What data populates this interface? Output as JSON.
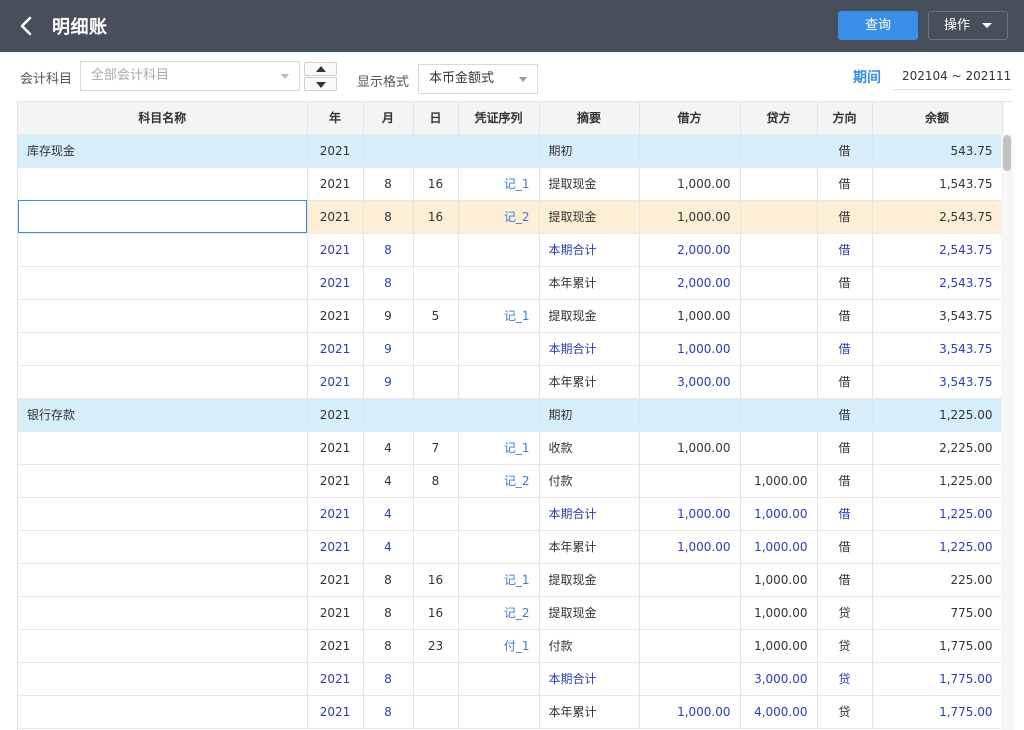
{
  "window": {
    "title": "明细账"
  },
  "toolbar": {
    "query_label": "查询",
    "ops_label": "操作"
  },
  "filters": {
    "account_label": "会计科目",
    "account_placeholder": "全部会计科目",
    "format_label": "显示格式",
    "format_value": "本币金额式",
    "period_label": "期间",
    "period_value": "202104 ~ 202111"
  },
  "table": {
    "headers": [
      "科目名称",
      "年",
      "月",
      "日",
      "凭证序列",
      "摘要",
      "借方",
      "贷方",
      "方向",
      "余额"
    ],
    "rows": [
      {
        "type": "group",
        "name": "库存现金",
        "year": "2021",
        "month": "",
        "day": "",
        "voucher": "",
        "summary": "期初",
        "debit": "",
        "credit": "",
        "dir": "借",
        "balance": "543.75"
      },
      {
        "type": "entry",
        "name": "",
        "year": "2021",
        "month": "8",
        "day": "16",
        "voucher": "记_1",
        "summary": "提取现金",
        "debit": "1,000.00",
        "credit": "",
        "dir": "借",
        "balance": "1,543.75"
      },
      {
        "type": "highlight",
        "name": "",
        "year": "2021",
        "month": "8",
        "day": "16",
        "voucher": "记_2",
        "summary": "提取现金",
        "debit": "1,000.00",
        "credit": "",
        "dir": "借",
        "balance": "2,543.75"
      },
      {
        "type": "sum",
        "name": "",
        "year": "2021",
        "month": "8",
        "day": "",
        "voucher": "",
        "summary": "本期合计",
        "debit": "2,000.00",
        "credit": "",
        "dir": "借",
        "balance": "2,543.75"
      },
      {
        "type": "cum",
        "name": "",
        "year": "2021",
        "month": "8",
        "day": "",
        "voucher": "",
        "summary": "本年累计",
        "debit": "2,000.00",
        "credit": "",
        "dir": "借",
        "balance": "2,543.75"
      },
      {
        "type": "entry",
        "name": "",
        "year": "2021",
        "month": "9",
        "day": "5",
        "voucher": "记_1",
        "summary": "提取现金",
        "debit": "1,000.00",
        "credit": "",
        "dir": "借",
        "balance": "3,543.75"
      },
      {
        "type": "sum",
        "name": "",
        "year": "2021",
        "month": "9",
        "day": "",
        "voucher": "",
        "summary": "本期合计",
        "debit": "1,000.00",
        "credit": "",
        "dir": "借",
        "balance": "3,543.75"
      },
      {
        "type": "cum",
        "name": "",
        "year": "2021",
        "month": "9",
        "day": "",
        "voucher": "",
        "summary": "本年累计",
        "debit": "3,000.00",
        "credit": "",
        "dir": "借",
        "balance": "3,543.75"
      },
      {
        "type": "group",
        "name": "银行存款",
        "year": "2021",
        "month": "",
        "day": "",
        "voucher": "",
        "summary": "期初",
        "debit": "",
        "credit": "",
        "dir": "借",
        "balance": "1,225.00"
      },
      {
        "type": "entry",
        "name": "",
        "year": "2021",
        "month": "4",
        "day": "7",
        "voucher": "记_1",
        "summary": "收款",
        "debit": "1,000.00",
        "credit": "",
        "dir": "借",
        "balance": "2,225.00"
      },
      {
        "type": "entry",
        "name": "",
        "year": "2021",
        "month": "4",
        "day": "8",
        "voucher": "记_2",
        "summary": "付款",
        "debit": "",
        "credit": "1,000.00",
        "dir": "借",
        "balance": "1,225.00"
      },
      {
        "type": "sum",
        "name": "",
        "year": "2021",
        "month": "4",
        "day": "",
        "voucher": "",
        "summary": "本期合计",
        "debit": "1,000.00",
        "credit": "1,000.00",
        "dir": "借",
        "balance": "1,225.00"
      },
      {
        "type": "cum",
        "name": "",
        "year": "2021",
        "month": "4",
        "day": "",
        "voucher": "",
        "summary": "本年累计",
        "debit": "1,000.00",
        "credit": "1,000.00",
        "dir": "借",
        "balance": "1,225.00"
      },
      {
        "type": "entry",
        "name": "",
        "year": "2021",
        "month": "8",
        "day": "16",
        "voucher": "记_1",
        "summary": "提取现金",
        "debit": "",
        "credit": "1,000.00",
        "dir": "借",
        "balance": "225.00"
      },
      {
        "type": "entry",
        "name": "",
        "year": "2021",
        "month": "8",
        "day": "16",
        "voucher": "记_2",
        "summary": "提取现金",
        "debit": "",
        "credit": "1,000.00",
        "dir": "贷",
        "balance": "775.00"
      },
      {
        "type": "entry",
        "name": "",
        "year": "2021",
        "month": "8",
        "day": "23",
        "voucher": "付_1",
        "summary": "付款",
        "debit": "",
        "credit": "1,000.00",
        "dir": "贷",
        "balance": "1,775.00"
      },
      {
        "type": "sum",
        "name": "",
        "year": "2021",
        "month": "8",
        "day": "",
        "voucher": "",
        "summary": "本期合计",
        "debit": "",
        "credit": "3,000.00",
        "dir": "贷",
        "balance": "1,775.00"
      },
      {
        "type": "cum",
        "name": "",
        "year": "2021",
        "month": "8",
        "day": "",
        "voucher": "",
        "summary": "本年累计",
        "debit": "1,000.00",
        "credit": "4,000.00",
        "dir": "贷",
        "balance": "1,775.00"
      }
    ]
  },
  "icons": {
    "back": "chevron-left-icon",
    "ops_caret": "caret-down-icon"
  },
  "colors": {
    "titlebar": "#474f5a",
    "accent": "#3b8ee8",
    "group_row": "#d6eef9",
    "selected_row": "#fdefd5",
    "sum_text": "#2a3db4"
  }
}
